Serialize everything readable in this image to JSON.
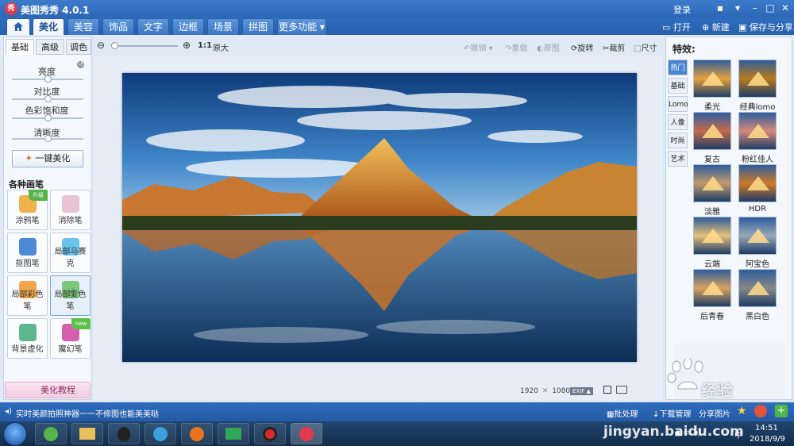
{
  "app": {
    "title": "美图秀秀 4.0.1",
    "icon_text": "秀",
    "login": "登录"
  },
  "window_controls": {
    "skin": "▪",
    "minimize": "–",
    "maximize": "□",
    "close": "✕"
  },
  "menu": {
    "home_icon": "home-icon",
    "tabs": [
      "美化",
      "美容",
      "饰品",
      "文字",
      "边框",
      "场景",
      "拼图",
      "更多功能 ▾"
    ],
    "active": "美化",
    "right": {
      "open": "打开",
      "new": "新建",
      "save_share": "保存与分享"
    }
  },
  "left_panel": {
    "tabs": [
      "基础",
      "高级",
      "调色"
    ],
    "sliders": [
      "亮度",
      "对比度",
      "色彩饱和度",
      "清晰度"
    ],
    "beautify_button": "一键美化",
    "brushes_heading": "各种画笔",
    "brushes": [
      {
        "label": "涂鸦笔",
        "badge": "升级",
        "color": "#f0b24a"
      },
      {
        "label": "消除笔",
        "badge": "",
        "color": "#e8c4d2"
      },
      {
        "label": "抠图笔",
        "badge": "",
        "color": "#4d8ad6"
      },
      {
        "label": "局部马赛克",
        "badge": "",
        "color": "#69c3ea"
      },
      {
        "label": "局部彩色笔",
        "badge": "",
        "color": "#f1a64c"
      },
      {
        "label": "局部变色笔",
        "badge": "",
        "color": "#7cc57a"
      },
      {
        "label": "背景虚化",
        "badge": "",
        "color": "#5cb68f"
      },
      {
        "label": "魔幻笔",
        "badge": "new",
        "color": "#d85fb0"
      }
    ],
    "tutorial": "美化教程"
  },
  "canvas_toolbar": {
    "zoom_ratio": "1:1",
    "original": "原大",
    "undo": "撤销",
    "redo": "重做",
    "original_img": "原图",
    "rotate": "旋转",
    "crop": "裁剪",
    "size": "尺寸"
  },
  "image": {
    "width": "1920",
    "height": "1080",
    "times": "✕",
    "exif": "EXIF ▲"
  },
  "right_panel": {
    "heading": "特效:",
    "categories": [
      "热门",
      "基础",
      "Lomo",
      "人像",
      "时尚",
      "艺术"
    ],
    "active_category": "热门",
    "effects": [
      {
        "label": "柔光",
        "tint": "#e7a03c"
      },
      {
        "label": "经典lomo",
        "tint": "#b97a1c"
      },
      {
        "label": "复古",
        "tint": "#c46a4a"
      },
      {
        "label": "粉红佳人",
        "tint": "#d58a7a"
      },
      {
        "label": "淡雅",
        "tint": "#c39a6a"
      },
      {
        "label": "HDR",
        "tint": "#d07a28"
      },
      {
        "label": "云端",
        "tint": "#e6c07a"
      },
      {
        "label": "阿宝色",
        "tint": "#9aa8b8"
      },
      {
        "label": "后青春",
        "tint": "#d9a25e"
      },
      {
        "label": "黑白色",
        "tint": "#888888"
      }
    ]
  },
  "statusbar": {
    "tip": "实时美颜拍照神器一一不修图也能美美哒",
    "batch": "批处理",
    "download_manager": "下载管理",
    "share_image": "分享图片"
  },
  "taskbar": {
    "time": "14:51",
    "date": "2018/9/9",
    "language": "中"
  },
  "watermark": {
    "text": "Baidu经验",
    "url": "jingyan.baidu.com"
  }
}
